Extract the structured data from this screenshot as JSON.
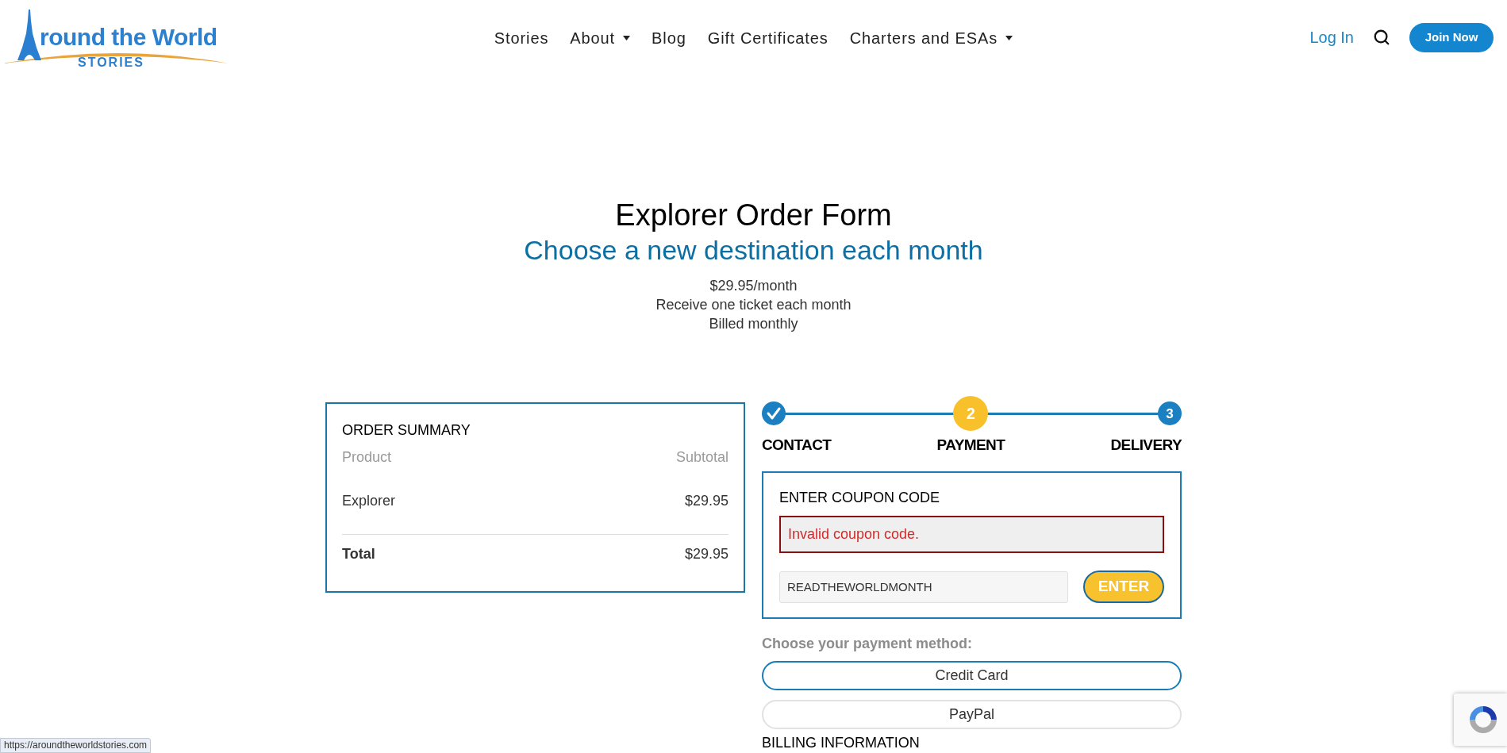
{
  "header": {
    "logo": {
      "title": "round the World",
      "subtitle": "STORIES"
    },
    "nav": [
      {
        "label": "Stories",
        "has_menu": false
      },
      {
        "label": "About",
        "has_menu": true
      },
      {
        "label": "Blog",
        "has_menu": false
      },
      {
        "label": "Gift Certificates",
        "has_menu": false
      },
      {
        "label": "Charters and ESAs",
        "has_menu": true
      }
    ],
    "login": "Log In",
    "join_button": "Join Now"
  },
  "intro": {
    "title": "Explorer Order Form",
    "subtitle": "Choose a new destination each month",
    "details": [
      "$29.95/month",
      "Receive one ticket each month",
      "Billed monthly"
    ]
  },
  "order_summary": {
    "title": "ORDER SUMMARY",
    "columns": [
      "Product",
      "Subtotal"
    ],
    "rows": [
      {
        "product": "Explorer",
        "subtotal": "$29.95"
      }
    ],
    "total": {
      "label": "Total",
      "amount": "$29.95"
    }
  },
  "steps": [
    {
      "label": "CONTACT",
      "completed": true,
      "selected": false
    },
    {
      "number": "2",
      "label": "PAYMENT",
      "completed": false,
      "selected": true
    },
    {
      "number": "3",
      "label": "DELIVERY",
      "completed": false,
      "selected": false
    }
  ],
  "coupon": {
    "title": "ENTER COUPON CODE",
    "error": "Invalid coupon code.",
    "value": "READTHEWORLDMONTH",
    "button": "ENTER"
  },
  "payment": {
    "prompt": "Choose your payment method:",
    "methods": [
      {
        "label": "Credit Card",
        "selected": true
      },
      {
        "label": "PayPal",
        "selected": false
      }
    ]
  },
  "billing": {
    "title": "BILLING INFORMATION"
  },
  "status_bar": {
    "url": "https://aroundtheworldstories.com"
  }
}
